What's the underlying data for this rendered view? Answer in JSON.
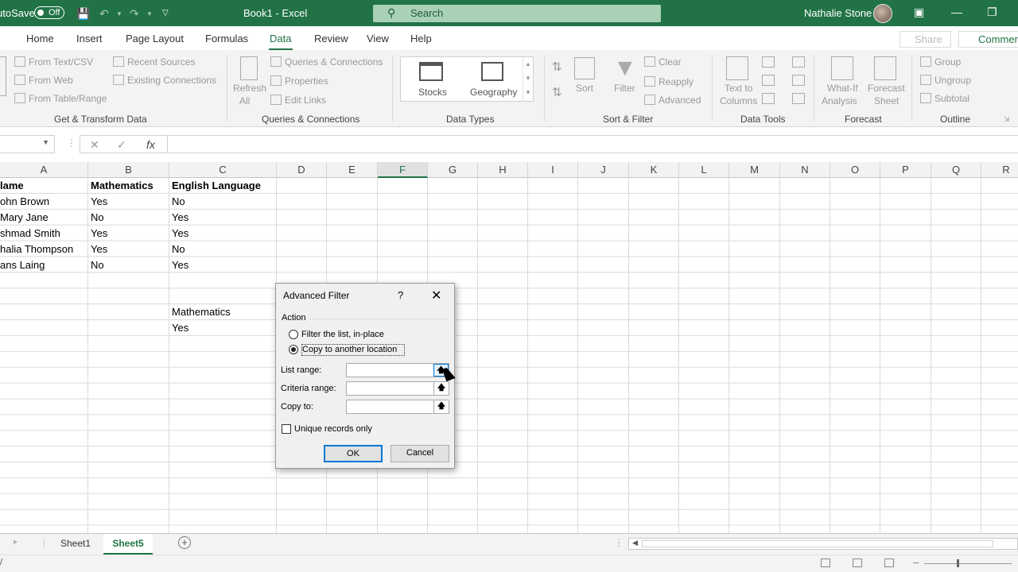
{
  "titlebar": {
    "autosave_label": "utoSave",
    "autosave_state": "Off",
    "doc_title": "Book1 - Excel",
    "search_placeholder": "Search",
    "user_name": "Nathalie Stone"
  },
  "menu": {
    "tabs": [
      "Home",
      "Insert",
      "Page Layout",
      "Formulas",
      "Data",
      "Review",
      "View",
      "Help"
    ],
    "active_tab": "Data",
    "share_label": "Share",
    "comments_label": "Commer"
  },
  "ribbon": {
    "get_transform": {
      "items": [
        "From Text/CSV",
        "From Web",
        "From Table/Range",
        "Recent Sources",
        "Existing Connections"
      ],
      "group_label": "Get & Transform Data"
    },
    "queries": {
      "refresh_line1": "Refresh",
      "refresh_line2": "All",
      "items": [
        "Queries & Connections",
        "Properties",
        "Edit Links"
      ],
      "group_label": "Queries & Connections"
    },
    "data_types": {
      "items": [
        "Stocks",
        "Geography"
      ],
      "group_label": "Data Types"
    },
    "sort_filter": {
      "sort_label": "Sort",
      "filter_label": "Filter",
      "items": [
        "Clear",
        "Reapply",
        "Advanced"
      ],
      "group_label": "Sort & Filter"
    },
    "data_tools": {
      "text_to_columns_line1": "Text to",
      "text_to_columns_line2": "Columns",
      "group_label": "Data Tools"
    },
    "forecast": {
      "whatif_line1": "What-If",
      "whatif_line2": "Analysis",
      "sheet_line1": "Forecast",
      "sheet_line2": "Sheet",
      "group_label": "Forecast"
    },
    "outline": {
      "items": [
        "Group",
        "Ungroup",
        "Subtotal"
      ],
      "group_label": "Outline"
    }
  },
  "formula_bar": {
    "fx_label": "fx",
    "value": ""
  },
  "grid": {
    "columns": [
      "A",
      "B",
      "C",
      "D",
      "E",
      "F",
      "G",
      "H",
      "I",
      "J",
      "K",
      "L",
      "M",
      "N",
      "O",
      "P",
      "Q",
      "R"
    ],
    "selected_column": "F",
    "rows": [
      [
        "lame",
        "Mathematics",
        "English Language"
      ],
      [
        "ohn Brown",
        "Yes",
        "No"
      ],
      [
        "Mary Jane",
        "No",
        "Yes"
      ],
      [
        "shmad Smith",
        "Yes",
        "Yes"
      ],
      [
        "halia Thompson",
        "Yes",
        "No"
      ],
      [
        "ans Laing",
        "No",
        "Yes"
      ]
    ],
    "criteria_header": "Mathematics",
    "criteria_value": "Yes"
  },
  "dialog": {
    "title": "Advanced Filter",
    "help": "?",
    "action_label": "Action",
    "option_filter": "Filter the list, in-place",
    "option_copy": "Copy to another location",
    "selected_option": "copy",
    "list_range_label": "List range:",
    "criteria_range_label": "Criteria range:",
    "copy_to_label": "Copy to:",
    "list_range_value": "",
    "criteria_range_value": "",
    "copy_to_value": "",
    "unique_label": "Unique records only",
    "unique_checked": false,
    "ok_label": "OK",
    "cancel_label": "Cancel"
  },
  "sheets": {
    "tabs": [
      "Sheet1",
      "Sheet5"
    ],
    "active": "Sheet5"
  },
  "colors": {
    "accent": "#217346",
    "dialog_focus": "#0078d7"
  }
}
